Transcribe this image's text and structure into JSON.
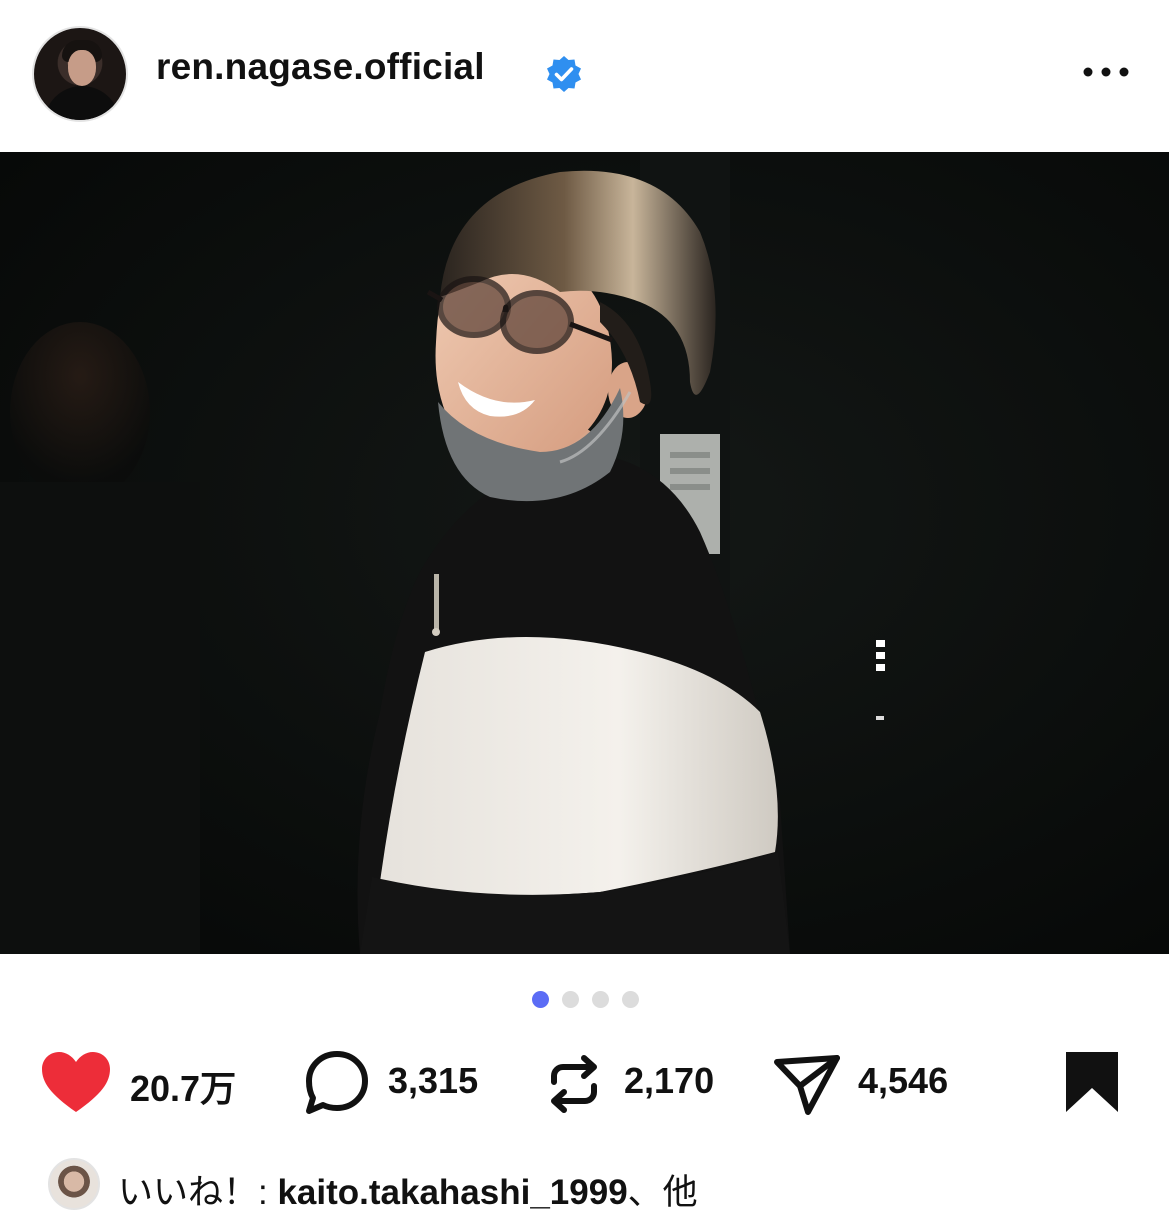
{
  "post": {
    "username": "ren.nagase.official",
    "verified": true,
    "more_label": "•••",
    "carousel": {
      "count": 4,
      "active_index": 0
    },
    "accent_color": "#5b6cf5"
  },
  "actions": {
    "like_count": "20.7万",
    "comment_count": "3,315",
    "repost_count": "2,170",
    "share_count": "4,546",
    "liked": true,
    "like_color": "#ed2d39"
  },
  "liked_by": {
    "prefix": "いいね！: ",
    "user": "kaito.takahashi_1999",
    "suffix": "、他"
  },
  "icons": {
    "verified": "verified-badge-icon",
    "more": "more-options-icon",
    "like": "heart-icon",
    "comment": "comment-icon",
    "repost": "repost-icon",
    "share": "send-icon",
    "save": "bookmark-icon"
  }
}
